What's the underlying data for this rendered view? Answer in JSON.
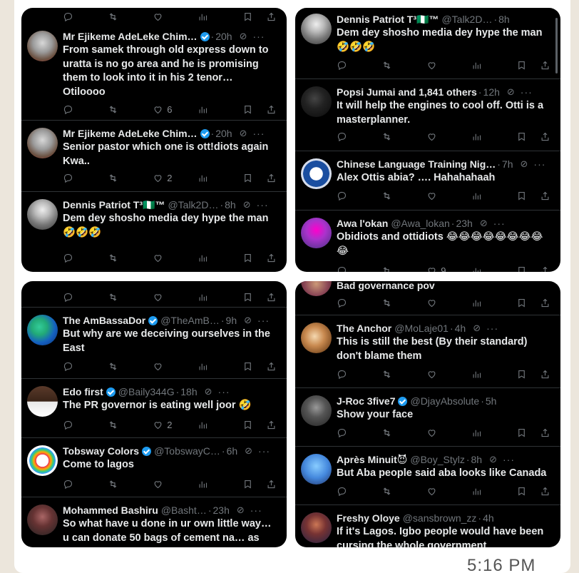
{
  "timestamp": "5:16 PM",
  "panels": {
    "p1": {
      "tweets": [
        {
          "name": "Mr Ejikeme AdeLeke Chim…",
          "verified": true,
          "handle": "",
          "time": "20h",
          "text": "From samek through old express down to uratta is no go area and  he is promising them to look into it in his  2 tenor… Otiloooo",
          "likes": "6"
        },
        {
          "name": "Mr Ejikeme AdeLeke Chim…",
          "verified": true,
          "handle": "",
          "time": "20h",
          "text": "Senior pastor which one is ott!diots again Kwa..",
          "likes": "2"
        },
        {
          "name": "Dennis Patriot T³🇳🇬™",
          "verified": false,
          "handle": "@Talk2D…",
          "time": "8h",
          "text": "Dem dey shosho media dey hype the man 🤣🤣🤣",
          "likes": ""
        }
      ]
    },
    "p2": {
      "tweets": [
        {
          "name": "Dennis Patriot T³🇳🇬™",
          "verified": false,
          "handle": "@Talk2D…",
          "time": "8h",
          "text": "Dem dey shosho media dey hype the man 🤣🤣🤣",
          "likes": ""
        },
        {
          "name": "Popsi Jumai and 1,841 others",
          "verified": false,
          "handle": "",
          "time": "12h",
          "text": "It will help the engines to cool off. Otti is a masterplanner.",
          "likes": ""
        },
        {
          "name": "Chinese Language Training Nig…",
          "verified": false,
          "handle": "",
          "time": "7h",
          "text": "Alex Ottis abia? …. Hahahahaah",
          "likes": ""
        },
        {
          "name": "Awa l'okan",
          "verified": false,
          "handle": "@Awa_lokan",
          "time": "23h",
          "text": "Obidiots and ottidiots 😂😂😂😂😂😂😂😂😂",
          "likes": "9"
        }
      ]
    },
    "p3": {
      "tweets": [
        {
          "name": "The AmBassaDor",
          "verified": true,
          "handle": "@TheAmB…",
          "time": "9h",
          "text": "But why are we deceiving ourselves in the East",
          "likes": ""
        },
        {
          "name": "Edo first",
          "verified": true,
          "handle": "@Baily344G",
          "time": "18h",
          "text": "The PR governor is eating well joor 🤣",
          "likes": "2"
        },
        {
          "name": "Tobsway Colors",
          "verified": true,
          "handle": "@TobswayC…",
          "time": "6h",
          "text": "Come to lagos",
          "likes": ""
        },
        {
          "name": "Mohammed Bashiru",
          "verified": false,
          "handle": "@Basht…",
          "time": "23h",
          "text": "So what have u done in ur own little way… u can donate 50 bags of cement na… as",
          "likes": ""
        }
      ]
    },
    "p4": {
      "top_cut_text": "Bad governance pov",
      "tweets": [
        {
          "name": "The Anchor",
          "verified": false,
          "handle": "@MoLaje01",
          "time": "4h",
          "text": "This is still the best (By their standard) don't blame them",
          "likes": ""
        },
        {
          "name": "J-Roc 3five7",
          "verified": true,
          "handle": "@DjayAbsolute",
          "time": "5h",
          "text": "Show your face",
          "likes": ""
        },
        {
          "name": "Après Minuit😈",
          "verified": false,
          "handle": "@Boy_Stylz",
          "time": "8h",
          "text": "But Aba people said aba looks like Canada",
          "likes": ""
        },
        {
          "name": "Freshy Oloye",
          "verified": false,
          "handle": "@sansbrown_zz",
          "time": "4h",
          "text": "If it's Lagos. Igbo people would have been cursing the whole government",
          "likes": ""
        }
      ]
    }
  },
  "colors": {
    "panel_bg": "#000000",
    "text": "#e7e9ea",
    "muted": "#71767b",
    "verified": "#1d9bf0",
    "chat_bg": "#ece6dc"
  },
  "icons": [
    "reply-icon",
    "retweet-icon",
    "like-icon",
    "views-icon",
    "bookmark-icon",
    "share-icon",
    "grok-icon",
    "more-icon",
    "verified-badge-icon"
  ]
}
